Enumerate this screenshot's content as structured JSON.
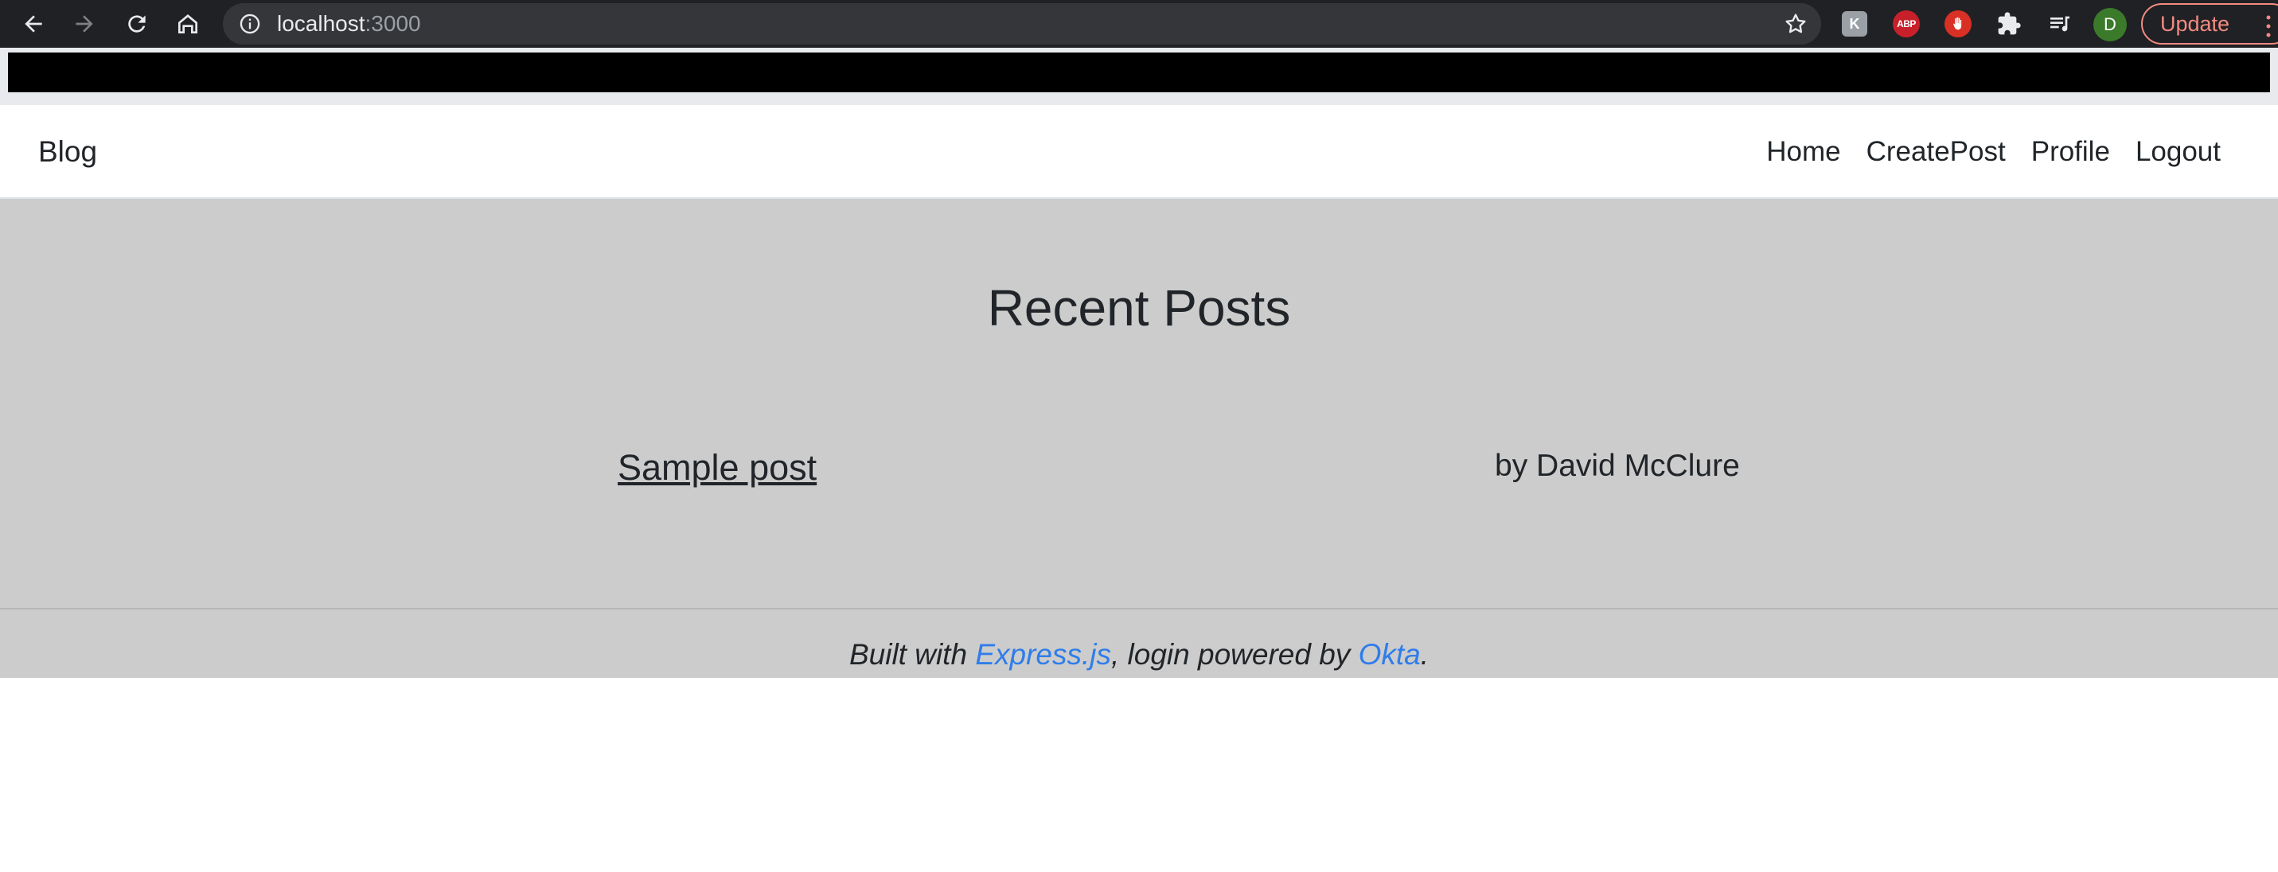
{
  "browser": {
    "url_host": "localhost",
    "url_port": ":3000",
    "avatar_letter": "D",
    "update_label": "Update",
    "extensions": {
      "k_label": "K",
      "abp_label": "ABP"
    },
    "icons": [
      "back-icon",
      "forward-icon",
      "reload-icon",
      "home-icon",
      "info-icon",
      "star-icon",
      "puzzle-icon",
      "reading-list-icon",
      "menu-dots-icon"
    ]
  },
  "navbar": {
    "brand": "Blog",
    "links": [
      "Home",
      "CreatePost",
      "Profile",
      "Logout"
    ]
  },
  "main": {
    "title": "Recent Posts",
    "posts": [
      {
        "title": "Sample post",
        "author": "by David McClure"
      }
    ]
  },
  "footer": {
    "prefix": "Built with ",
    "express_link": "Express.js",
    "middle": ", login powered by ",
    "okta_link": "Okta",
    "suffix": "."
  },
  "colors": {
    "chrome_bg": "#202124",
    "page_bg": "#cccccc",
    "link_blue": "#2f7dea",
    "update_accent": "#f28b82"
  }
}
